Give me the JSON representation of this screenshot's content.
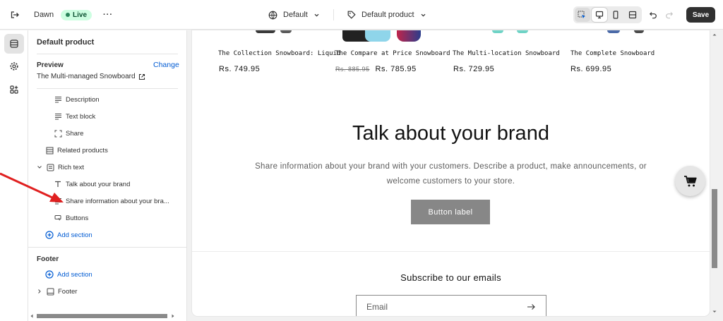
{
  "topbar": {
    "theme_name": "Dawn",
    "live_label": "Live",
    "language_selector": "Default",
    "template_selector": "Default product",
    "save_label": "Save"
  },
  "panel": {
    "title": "Default product",
    "preview_label": "Preview",
    "change_label": "Change",
    "preview_product": "The Multi-managed Snowboard",
    "tree": [
      {
        "label": "Description",
        "icon": "text-lines-icon"
      },
      {
        "label": "Text block",
        "icon": "text-lines-icon"
      },
      {
        "label": "Share",
        "icon": "share-frame-icon"
      },
      {
        "label": "Related products",
        "icon": "grid-list-icon"
      },
      {
        "label": "Rich text",
        "icon": "richtext-icon"
      },
      {
        "label": "Talk about your brand",
        "icon": "heading-t-icon"
      },
      {
        "label": "Share information about your bra...",
        "icon": "text-lines-icon"
      },
      {
        "label": "Buttons",
        "icon": "cursor-button-icon"
      }
    ],
    "add_section_label": "Add section",
    "footer_heading": "Footer",
    "footer_add_section_label": "Add section",
    "footer_item_label": "Footer"
  },
  "preview": {
    "products": [
      {
        "name": "The Collection Snowboard: Liquid",
        "price": "Rs. 749.95",
        "compare_at": ""
      },
      {
        "name": "The Compare at Price Snowboard",
        "price": "Rs. 785.95",
        "compare_at": "Rs. 885.95"
      },
      {
        "name": "The Multi-location Snowboard",
        "price": "Rs. 729.95",
        "compare_at": ""
      },
      {
        "name": "The Complete Snowboard",
        "price": "Rs. 699.95",
        "compare_at": ""
      }
    ],
    "brand_heading": "Talk about your brand",
    "brand_text": "Share information about your brand with your customers. Describe a product, make announcements, or welcome customers to your store.",
    "button_label": "Button label",
    "subscribe_heading": "Subscribe to our emails",
    "email_placeholder": "Email"
  },
  "colors": {
    "accent_blue": "#005bd3",
    "live_badge": "#cdfee1",
    "annotation_arrow": "#e02020"
  }
}
